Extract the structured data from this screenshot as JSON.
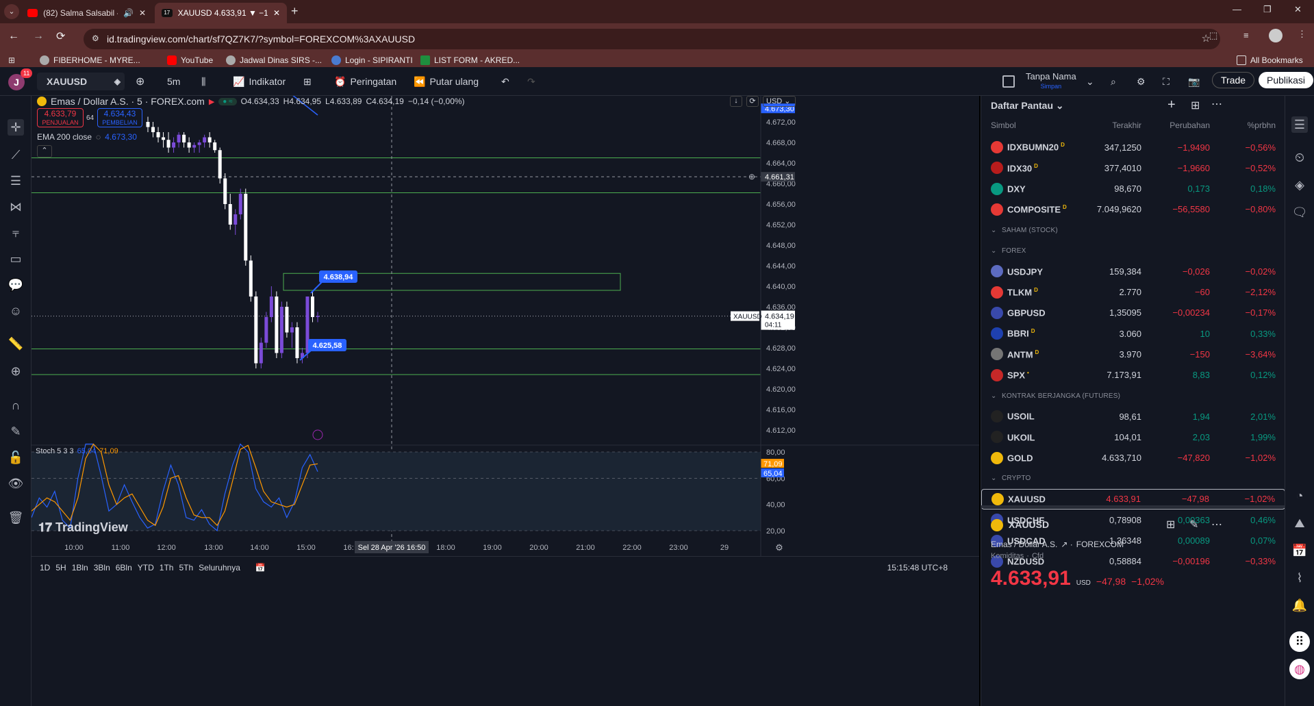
{
  "browser": {
    "tabs": [
      {
        "label": "(82) Salma Salsabil - Bunga"
      },
      {
        "label": "XAUUSD 4.633,91 ▼ −1.02% Ta"
      }
    ],
    "url": "id.tradingview.com/chart/sf7QZ7K7/?symbol=FOREXCOM%3AXAUUSD",
    "bookmarks": [
      "FIBERHOME - MYRE...",
      "YouTube",
      "Jadwal Dinas SIRS -...",
      "Login - SIPIRANTI",
      "LIST FORM - AKRED..."
    ],
    "all_bookmarks": "All Bookmarks"
  },
  "toolbar": {
    "avatar_letter": "J",
    "notif_count": "11",
    "symbol": "XAUUSD",
    "interval": "5m",
    "indicators": "Indikator",
    "alert": "Peringatan",
    "replay": "Putar ulang",
    "layout_name": "Tanpa Nama",
    "layout_status": "Simpan",
    "trade": "Trade",
    "publish": "Publikasi"
  },
  "legend": {
    "title": "Emas / Dollar A.S. · 5 · FOREX.com",
    "o": "O4.634,33",
    "h": "H4.634,95",
    "l": "L4.633,89",
    "c": "C4.634,19",
    "chg": "−0,14 (−0,00%)",
    "sell_price": "4.633,79",
    "sell_label": "PENJUALAN",
    "spread": "64",
    "buy_price": "4.634,43",
    "buy_label": "PEMBELIAN",
    "ema_label": "EMA 200 close",
    "ema_value": "4.673,30",
    "currency": "USD"
  },
  "chart_data": {
    "type": "candlestick",
    "symbol": "XAUUSD",
    "price_ticks": [
      "4.672,00",
      "4.668,00",
      "4.664,00",
      "4.660,00",
      "4.656,00",
      "4.652,00",
      "4.648,00",
      "4.644,00",
      "4.640,00",
      "4.636,00",
      "4.632,00",
      "4.628,00",
      "4.624,00",
      "4.620,00",
      "4.616,00",
      "4.612,00"
    ],
    "time_ticks": [
      "10:00",
      "11:00",
      "12:00",
      "13:00",
      "14:00",
      "15:00",
      "16:",
      "18:00",
      "19:00",
      "20:00",
      "21:00",
      "22:00",
      "23:00",
      "29"
    ],
    "crosshair_time": "Sel 28 Apr '26   16:50",
    "crosshair_price": "4.661,31",
    "ema_price": "4.673,30",
    "last_price": "4.634,19",
    "last_countdown": "04:11",
    "last_symbol": "XAUUSD",
    "horizontal_lines": [
      4665.0,
      4658.2,
      4627.8,
      4622.8
    ],
    "rect_box": {
      "top": 4642.5,
      "bottom": 4639.2
    },
    "annotations": [
      "4.638,94",
      "4.625,58"
    ],
    "candles": [
      [
        4672,
        4673,
        4670,
        4671
      ],
      [
        4671,
        4672,
        4669,
        4670
      ],
      [
        4670,
        4671,
        4668,
        4669
      ],
      [
        4669,
        4670,
        4667,
        4668.5
      ],
      [
        4668.5,
        4670,
        4666,
        4667
      ],
      [
        4667,
        4669,
        4666,
        4668
      ],
      [
        4668,
        4670,
        4667,
        4669.5
      ],
      [
        4669.5,
        4670,
        4667,
        4668
      ],
      [
        4668,
        4669,
        4666,
        4667
      ],
      [
        4667,
        4668,
        4666,
        4667.5
      ],
      [
        4667.5,
        4668.5,
        4666,
        4668
      ],
      [
        4668,
        4669.5,
        4667,
        4669
      ],
      [
        4669,
        4670,
        4667,
        4668
      ],
      [
        4668,
        4668.5,
        4666,
        4666.5
      ],
      [
        4666.5,
        4667,
        4660,
        4661
      ],
      [
        4661,
        4662,
        4655,
        4656
      ],
      [
        4656,
        4658,
        4651,
        4652
      ],
      [
        4652,
        4655,
        4650,
        4654
      ],
      [
        4654,
        4659,
        4653,
        4658
      ],
      [
        4658,
        4659,
        4644,
        4645
      ],
      [
        4645,
        4646,
        4637,
        4638
      ],
      [
        4638,
        4639,
        4624,
        4625
      ],
      [
        4625,
        4630,
        4624,
        4629
      ],
      [
        4629,
        4635,
        4628,
        4634
      ],
      [
        4634,
        4640,
        4633,
        4638
      ],
      [
        4638,
        4639,
        4626,
        4627
      ],
      [
        4627,
        4637,
        4626,
        4636
      ],
      [
        4636,
        4637,
        4630,
        4631
      ],
      [
        4631,
        4633,
        4628,
        4632
      ],
      [
        4632,
        4633,
        4625,
        4626
      ],
      [
        4626,
        4628,
        4625,
        4627
      ],
      [
        4627,
        4638,
        4626,
        4638
      ],
      [
        4638,
        4639,
        4633,
        4634
      ],
      [
        4634,
        4635,
        4633,
        4634.2
      ]
    ],
    "stoch": {
      "label": "Stoch 5 3 3",
      "k_value": "65,04",
      "d_value": "71,09",
      "ticks": [
        "80,00",
        "60,00",
        "40,00",
        "20,00"
      ],
      "k_series": [
        30,
        45,
        38,
        50,
        28,
        22,
        60,
        88,
        95,
        62,
        35,
        40,
        55,
        42,
        30,
        22,
        25,
        50,
        70,
        55,
        30,
        28,
        36,
        25,
        20,
        48,
        70,
        92,
        80,
        52,
        42,
        38,
        45,
        30,
        42,
        68,
        78,
        65
      ],
      "d_series": [
        35,
        40,
        45,
        42,
        35,
        28,
        45,
        75,
        90,
        80,
        55,
        40,
        45,
        48,
        38,
        28,
        24,
        38,
        60,
        62,
        45,
        32,
        30,
        30,
        24,
        35,
        58,
        82,
        85,
        68,
        50,
        42,
        40,
        38,
        40,
        55,
        70,
        71
      ]
    },
    "watermark": "TradingView"
  },
  "bottom": {
    "ranges": [
      "1D",
      "5H",
      "1Bln",
      "3Bln",
      "6Bln",
      "YTD",
      "1Th",
      "5Th",
      "Seluruhnya"
    ],
    "clock": "15:15:48 UTC+8"
  },
  "watchlist": {
    "title": "Daftar Pantau",
    "headers": [
      "Simbol",
      "Terakhir",
      "Perubahan",
      "%prbhn"
    ],
    "rows": [
      {
        "sym": "IDXBUMN20",
        "sup": "D",
        "last": "347,1250",
        "chg": "−1,9490",
        "pct": "−0,56%",
        "neg": true,
        "color": "#e53935"
      },
      {
        "sym": "IDX30",
        "sup": "D",
        "last": "377,4010",
        "chg": "−1,9660",
        "pct": "−0,52%",
        "neg": true,
        "color": "#b71c1c"
      },
      {
        "sym": "DXY",
        "sup": "",
        "last": "98,670",
        "chg": "0,173",
        "pct": "0,18%",
        "neg": false,
        "color": "#089981"
      },
      {
        "sym": "COMPOSITE",
        "sup": "D",
        "last": "7.049,9620",
        "chg": "−56,5580",
        "pct": "−0,80%",
        "neg": true,
        "color": "#e53935"
      },
      {
        "section": "SAHAM (STOCK)"
      },
      {
        "section": "FOREX"
      },
      {
        "sym": "USDJPY",
        "sup": "",
        "last": "159,384",
        "chg": "−0,026",
        "pct": "−0,02%",
        "neg": true,
        "color": "#5c6bc0"
      },
      {
        "sym": "TLKM",
        "sup": "D",
        "last": "2.770",
        "chg": "−60",
        "pct": "−2,12%",
        "neg": true,
        "color": "#e53935"
      },
      {
        "sym": "GBPUSD",
        "sup": "",
        "last": "1,35095",
        "chg": "−0,00234",
        "pct": "−0,17%",
        "neg": true,
        "color": "#3949ab"
      },
      {
        "sym": "BBRI",
        "sup": "D",
        "last": "3.060",
        "chg": "10",
        "pct": "0,33%",
        "neg": false,
        "color": "#1e40af"
      },
      {
        "sym": "ANTM",
        "sup": "D",
        "last": "3.970",
        "chg": "−150",
        "pct": "−3,64%",
        "neg": true,
        "color": "#757575"
      },
      {
        "sym": "SPX",
        "sup": "•",
        "last": "7.173,91",
        "chg": "8,83",
        "pct": "0,12%",
        "neg": false,
        "color": "#c62828"
      },
      {
        "section": "KONTRAK BERJANGKA (FUTURES)"
      },
      {
        "sym": "USOIL",
        "sup": "",
        "last": "98,61",
        "chg": "1,94",
        "pct": "2,01%",
        "neg": false,
        "color": "#222"
      },
      {
        "sym": "UKOIL",
        "sup": "",
        "last": "104,01",
        "chg": "2,03",
        "pct": "1,99%",
        "neg": false,
        "color": "#222"
      },
      {
        "sym": "GOLD",
        "sup": "",
        "last": "4.633,710",
        "chg": "−47,820",
        "pct": "−1,02%",
        "neg": true,
        "color": "#f0b90b"
      },
      {
        "section": "CRYPTO"
      },
      {
        "sym": "XAUUSD",
        "sup": "",
        "last": "4.633,91",
        "chg": "−47,98",
        "pct": "−1,02%",
        "neg": true,
        "color": "#f0b90b",
        "selected": true
      },
      {
        "sym": "USDCHF",
        "sup": "",
        "last": "0,78908",
        "chg": "0,00363",
        "pct": "0,46%",
        "neg": false,
        "color": "#3949ab"
      },
      {
        "sym": "USDCAD",
        "sup": "",
        "last": "1,36348",
        "chg": "0,00089",
        "pct": "0,07%",
        "neg": false,
        "color": "#3949ab"
      },
      {
        "sym": "NZDUSD",
        "sup": "",
        "last": "0,58884",
        "chg": "−0,00196",
        "pct": "−0,33%",
        "neg": true,
        "color": "#3949ab"
      }
    ],
    "detail": {
      "symbol": "XAUUSD",
      "name": "Emas / Dollar A.S.",
      "exchange": "FOREXCOM",
      "type": "Komiditas",
      "subtype": "Cfd",
      "price": "4.633,91",
      "currency": "USD",
      "chg": "−47,98",
      "pct": "−1,02%"
    }
  }
}
